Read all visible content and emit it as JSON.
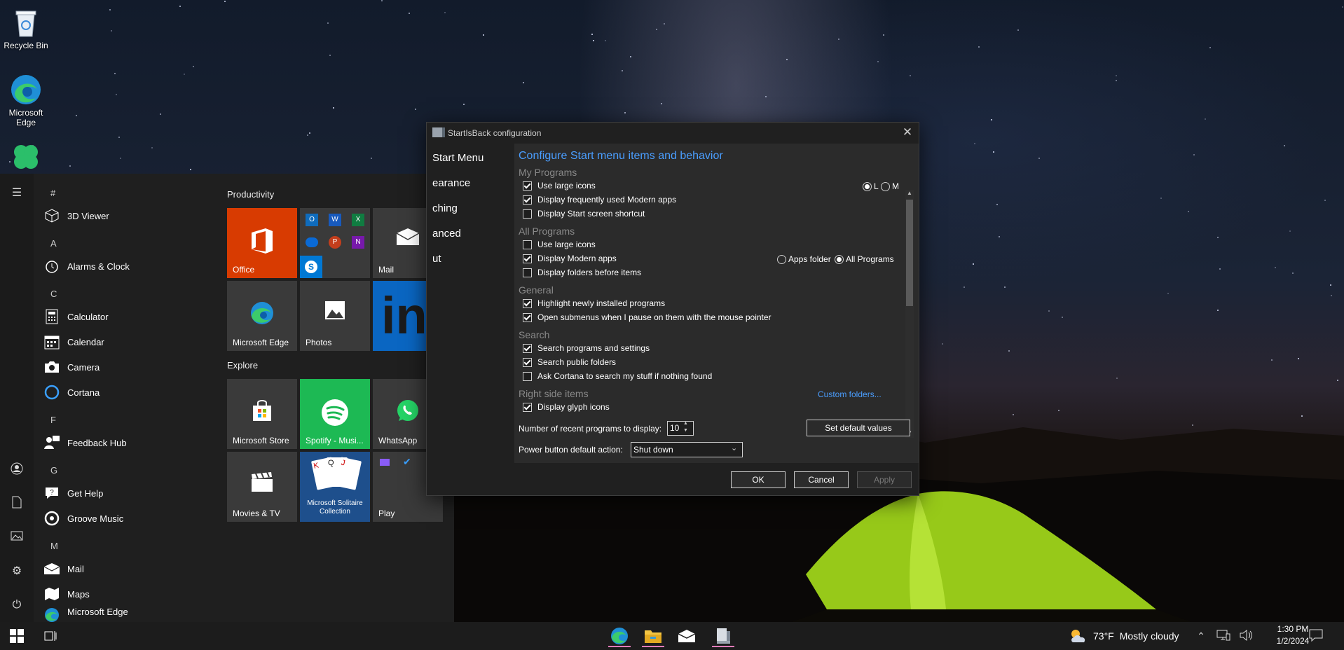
{
  "desktop": {
    "icons": [
      {
        "label": "Recycle Bin"
      },
      {
        "label": "Microsoft Edge"
      },
      {
        "label": ""
      }
    ]
  },
  "start_menu": {
    "letters": [
      "#",
      "A",
      "C",
      "F",
      "G",
      "M"
    ],
    "apps": {
      "viewer3d": "3D Viewer",
      "alarms": "Alarms & Clock",
      "calculator": "Calculator",
      "calendar": "Calendar",
      "camera": "Camera",
      "cortana": "Cortana",
      "feedback": "Feedback Hub",
      "gethelp": "Get Help",
      "groove": "Groove Music",
      "mail": "Mail",
      "maps": "Maps",
      "edge": "Microsoft Edge"
    },
    "groups": {
      "productivity": "Productivity",
      "explore": "Explore"
    },
    "tiles": {
      "office": "Office",
      "mail": "Mail",
      "edge": "Microsoft Edge",
      "photos": "Photos",
      "store": "Microsoft Store",
      "spotify": "Spotify - Musi...",
      "whatsapp": "WhatsApp",
      "movies": "Movies & TV",
      "solitaire": "Microsoft Solitaire Collection",
      "play": "Play"
    }
  },
  "dialog": {
    "title": "StartIsBack configuration",
    "nav": [
      "Start Menu",
      "Appearance",
      "Switching",
      "Advanced",
      "About"
    ],
    "nav_visible": [
      "Start Menu",
      "earance",
      "ching",
      "anced",
      "ut"
    ],
    "heading": "Configure Start menu items and behavior",
    "sections": {
      "my_programs": "My Programs",
      "all_programs": "All Programs",
      "general": "General",
      "search": "Search",
      "right_side": "Right side items"
    },
    "options": {
      "mp_large_icons": {
        "label": "Use large icons",
        "checked": true
      },
      "mp_modern_apps": {
        "label": "Display frequently used Modern apps",
        "checked": true
      },
      "mp_start_screen": {
        "label": "Display Start screen shortcut",
        "checked": false
      },
      "ap_large_icons": {
        "label": "Use large icons",
        "checked": false
      },
      "ap_modern_apps": {
        "label": "Display Modern apps",
        "checked": true
      },
      "ap_folders_before": {
        "label": "Display folders before items",
        "checked": false
      },
      "gen_highlight": {
        "label": "Highlight newly installed programs",
        "checked": true
      },
      "gen_submenus": {
        "label": "Open submenus when I pause on them with the mouse pointer",
        "checked": true
      },
      "s_programs": {
        "label": "Search programs and settings",
        "checked": true
      },
      "s_public": {
        "label": "Search public folders",
        "checked": true
      },
      "s_cortana": {
        "label": "Ask Cortana to search my stuff if nothing found",
        "checked": false
      },
      "r_glyph": {
        "label": "Display glyph icons",
        "checked": true
      }
    },
    "radios": {
      "size_l": "L",
      "size_m": "M",
      "apps_folder": "Apps folder",
      "all_programs": "All Programs"
    },
    "custom_folders": "Custom folders...",
    "recent_label": "Number of recent programs to display:",
    "recent_value": "10",
    "set_defaults": "Set default values",
    "power_label": "Power button default action:",
    "power_value": "Shut down",
    "ok": "OK",
    "cancel": "Cancel",
    "apply": "Apply"
  },
  "taskbar": {
    "weather_temp": "73°F",
    "weather_text": "Mostly cloudy",
    "time": "1:30 PM",
    "date": "1/2/2024"
  },
  "colors": {
    "accent_blue": "#4a9eff",
    "office_orange": "#d83b01",
    "spotify_green": "#1db954",
    "linkedin_blue": "#0a66c2",
    "tent_green": "#9fd41a"
  }
}
